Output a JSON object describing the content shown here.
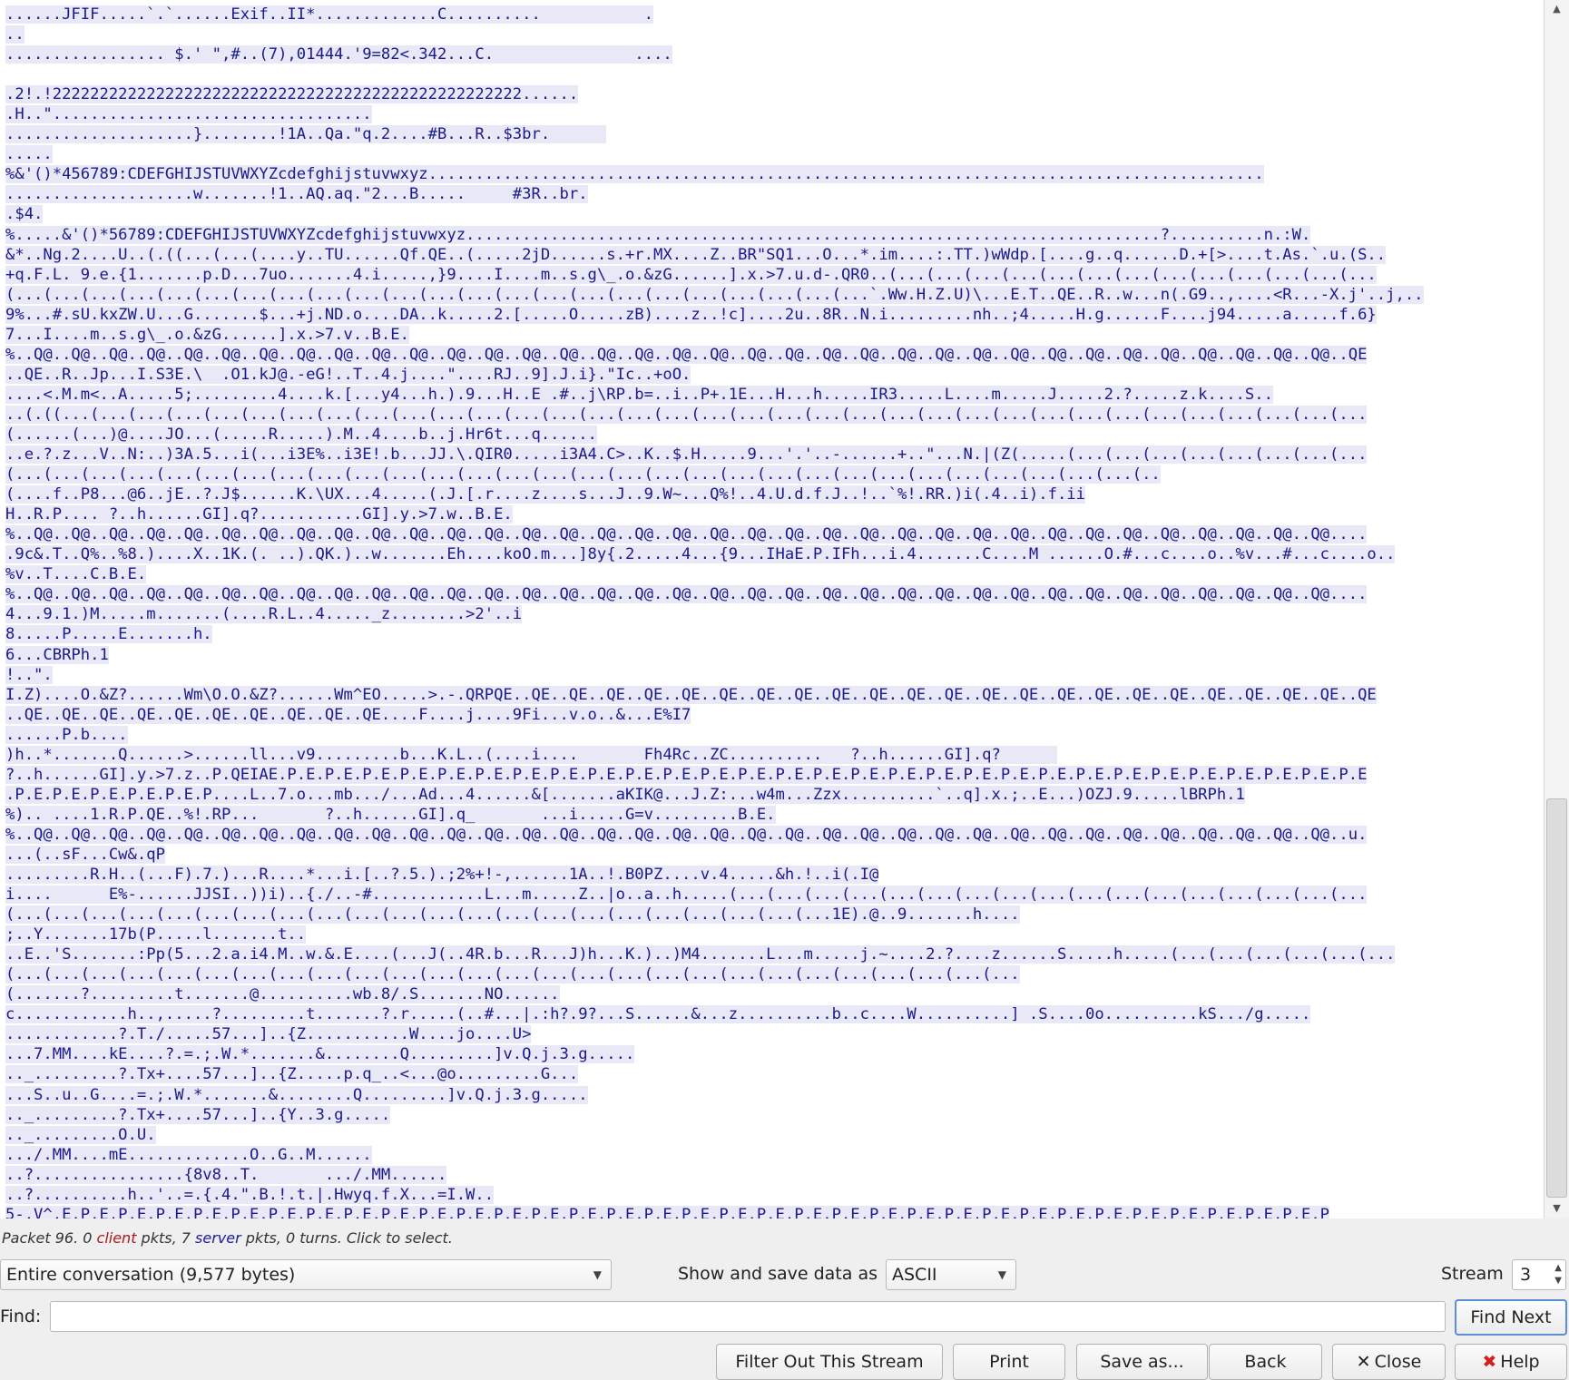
{
  "stream_lines": [
    "......JFIF.....`.`......Exif..II*.............C..........           .",
    "..",
    "................. $.' \",#..(7),01444.'9=82<.342...C.               ....",
    "",
    ".2!.!22222222222222222222222222222222222222222222222222......",
    ".H..\"..................................",
    "....................}........!1A..Qa.\"q.2....#B...R..$3br.      ",
    ".....",
    "%&'()*456789:CDEFGHIJSTUVWXYZcdefghijstuvwxyz.........................................................................................",
    "....................w.......!1..AQ.aq.\"2...B.....     #3R..br.",
    ".$4.",
    "%.....&'()*56789:CDEFGHIJSTUVWXYZcdefghijstuvwxyz..........................................................................?..........n.:W.",
    "&*..Ng.2....U..(.((...(...(....y..TU......Qf.QE..(.....2jD......s.+r.MX....Z..BR\"SQ1...O...*.im....:.TT.)wWdp.[....g..q......D.+[>....t.As.`.u.(S..",
    "+q.F.L. 9.e.{1.......p.D...7uo.......4.i.....,}9....I....m..s.g\\_.o.&zG......].x.>7.u.d-.QR0..(...(...(...(...(...(...(...(...(...(...(...(...(...",
    "(...(...(...(...(...(...(...(...(...(...(...(...(...(...(...(...(...(...(...(...(...(...(...`.Ww.H.Z.U)\\...E.T..QE..R..w...n(.G9..,....<R...-X.j'..j,..",
    "9%...#.sU.kxZW.U...G.......$...+j.ND.o....DA..k.....2.[.....O.....zB)....z..!c]....2u..8R..N.i.........nh..;4.....H.g......F....j94.....a.....f.6}",
    "7...I....m..s.g\\_.o.&zG......].x.>7.v..B.E.",
    "%..Q@..Q@..Q@..Q@..Q@..Q@..Q@..Q@..Q@..Q@..Q@..Q@..Q@..Q@..Q@..Q@..Q@..Q@..Q@..Q@..Q@..Q@..Q@..Q@..Q@..Q@..Q@..Q@..Q@..Q@..Q@..Q@..Q@..Q@..Q@..QE",
    "..QE..R..Jp...I.S3E.\\  .O1.kJ@.-eG!..T..4.j....\"....RJ..9].J.i}.\"Ic..+oO.",
    "....<.M.m<..A.....5;.........4....k.[...y4...h.).9...H..E .#..j\\RP.b=..i..P+.1E...H...h.....IR3.....L....m.....J.....2.?.....z.k....S..",
    "..(.((...(...(...(...(...(...(...(...(...(...(...(...(...(...(...(...(...(...(...(...(...(...(...(...(...(...(...(...(...(...(...(...(...(...(...",
    "(......(...)@....JO...(.....R.....).M..4....b..j.Hr6t...q......",
    "..e.?.z...V..N:..)3A.5...i(...i3E%..i3E!.b...JJ.\\.QIR0.....i3A4.C>..K..$.H.....9...'.'..-......+..\"...N.|(Z(.....(...(...(...(...(...(...(...(...",
    "(...(...(...(...(...(...(...(...(...(...(...(...(...(...(...(...(...(...(...(...(...(...(...(...(...(...(...(...(...(...(..",
    "(....f..P8...@6..jE..?.J$......K.\\UX...4.....(.J.[.r....z....s...J..9.W~...Q%!..4.U.d.f.J..!..`%!.RR.)i(.4..i).f.ii",
    "H..R.P.... ?..h......GI].q?...........GI].y.>7.w..B.E.",
    "%..Q@..Q@..Q@..Q@..Q@..Q@..Q@..Q@..Q@..Q@..Q@..Q@..Q@..Q@..Q@..Q@..Q@..Q@..Q@..Q@..Q@..Q@..Q@..Q@..Q@..Q@..Q@..Q@..Q@..Q@..Q@..Q@..Q@..Q@..Q@....",
    ".9c&.T..Q%..%8.)....X..1K.(. ..).QK.)..w.......Eh....koO.m...]8y{.2.....4...{9...IHaE.P.IFh...i.4.......C....M ......O.#...c....o..%v...#...c....o..",
    "%v..T....C.B.E.",
    "%..Q@..Q@..Q@..Q@..Q@..Q@..Q@..Q@..Q@..Q@..Q@..Q@..Q@..Q@..Q@..Q@..Q@..Q@..Q@..Q@..Q@..Q@..Q@..Q@..Q@..Q@..Q@..Q@..Q@..Q@..Q@..Q@..Q@..Q@..Q@....",
    "4...9.1.)M.....m.......(....R.L..4....._z........>2'..i",
    "8.....P.....E.......h.",
    "6...CBRPh.1",
    "!..\".",
    "I.Z)....O.&Z?......Wm\\O.O.&Z?......Wm^EO.....>.-.QRPQE..QE..QE..QE..QE..QE..QE..QE..QE..QE..QE..QE..QE..QE..QE..QE..QE..QE..QE..QE..QE..QE..QE..QE",
    "..QE..QE..QE..QE..QE..QE..QE..QE..QE..QE....F....j....9Fi...v.o..&...E%I7",
    "......P.b....",
    ")h..*.......Q......>......ll...v9.........b...K.L..(....i....       Fh4Rc..ZC..........   ?..h......GI].q?      ",
    "?..h......GI].y.>7.z..P.QEIAE.P.E.P.E.P.E.P.E.P.E.P.E.P.E.P.E.P.E.P.E.P.E.P.E.P.E.P.E.P.E.P.E.P.E.P.E.P.E.P.E.P.E.P.E.P.E.P.E.P.E.P.E.P.E.P.E.P.E",
    ".P.E.P.E.P.E.P.E.P.E.P....L..7.o...mb.../...Ad...4......&[.......aKIK@...J.Z:...w4m...Zzx..........`..q].x.;..E...)OZJ.9.....lBRPh.1",
    "%).. ....1.R.P.QE..%!.RP...       ?..h......GI].q_       ...i.....G=v.........B.E.",
    "%..Q@..Q@..Q@..Q@..Q@..Q@..Q@..Q@..Q@..Q@..Q@..Q@..Q@..Q@..Q@..Q@..Q@..Q@..Q@..Q@..Q@..Q@..Q@..Q@..Q@..Q@..Q@..Q@..Q@..Q@..Q@..Q@..Q@..Q@..Q@..u.",
    "...(..sF...Cw&.qP",
    ".........R.H..(...F).7.)...R....*...i.[..?.5.).;2%+!-,......1A..!.B0PZ....v.4.....&h.!..i(.I@",
    "i....      E%-......JJSI..))i)..{./..-#............L...m.....Z..|o..a..h.....(...(...(...(...(...(...(...(...(...(...(...(...(...(...(...(...(...",
    "(...(...(...(...(...(...(...(...(...(...(...(...(...(...(...(...(...(...(...(...(...(...1E).@..9.......h....",
    ";..Y.......17b(P.....l.......t..",
    "..E..'S.......:Pp(5...2.a.i4.M..w.&.E....(...J(..4R.b...R...J)h...K.)..)M4.......L...m.....j.~....2.?....z......S.....h.....(...(...(...(...(...(...",
    "(...(...(...(...(...(...(...(...(...(...(...(...(...(...(...(...(...(...(...(...(...(...(...(...(...(...(...",
    "(.......?.........t.......@..........wb.8/.S.......NO......",
    "c............h..,.....?.........t.......?.r.....(..#...|.:h?.9?...S......&...z..........b..c....W..........] .S....0o..........kS.../g.....",
    "............?.T./.....57...]..{Z...........W....jo....U>",
    "...7.MM....kE....?.=.;.W.*.......&........Q.........]v.Q.j.3.g.....",
    ".._.........?.Tx+....57...]..{Z.....p.q_..<...@o.........G...",
    "...S..u..G....=.;.W.*.......&........Q.........]v.Q.j.3.g.....",
    ".._.........?.Tx+....57...]..{Y..3.g.....",
    ".._.........O.U.",
    ".../.MM....mE.............O..G..M......",
    "..?................{8v8..T.       .../.MM......",
    "..?..........h..'..=.{.4.\".B.!.t.|.Hwyq.f.X...=I.W..",
    "5-.V^.E.P.E.P.E.P.E.P.E.P.E.P.E.P.E.P.E.P.E.P.E.P.E.P.E.P.E.P.E.P.E.P.E.P.E.P.E.P.E.P.E.P.E.P.E.P.E.P.E.P.E.P.E.P.E.P.E.P.E.P.E.P.E.P.E.P.E.P"
  ],
  "status": {
    "prefix": "Packet 96. 0 ",
    "client": "client",
    "middle": " pkts, 7 ",
    "server": "server",
    "suffix": " pkts, 0 turns. Click to select."
  },
  "conversation_select": "Entire conversation (9,577 bytes)",
  "show_as_label": "Show and save data as",
  "show_as_value": "ASCII",
  "stream_label": "Stream",
  "stream_value": "3",
  "find_label": "Find:",
  "find_value": "",
  "buttons": {
    "find_next": "Find Next",
    "filter_out": "Filter Out This Stream",
    "print": "Print",
    "save_as": "Save as...",
    "back": "Back",
    "close": "Close",
    "help": "Help"
  },
  "icons": {
    "close": "close-x-icon",
    "help": "help-icon"
  },
  "colors": {
    "client": "#b01818",
    "server": "#1a1a9a",
    "text_bg": "#e8e8f6"
  }
}
